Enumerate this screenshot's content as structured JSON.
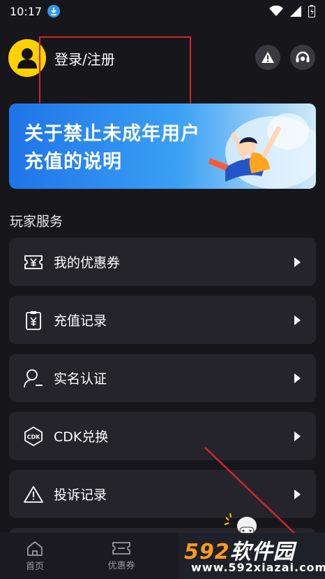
{
  "status_bar": {
    "time": "10:17"
  },
  "header": {
    "login_label": "登录/注册"
  },
  "banner": {
    "line1": "关于禁止未成年用户",
    "line2": "充值的说明"
  },
  "section": {
    "title": "玩家服务"
  },
  "menu": {
    "items": [
      {
        "label": "我的优惠券",
        "icon": "coupon-icon"
      },
      {
        "label": "充值记录",
        "icon": "recharge-record-icon"
      },
      {
        "label": "实名认证",
        "icon": "user-verify-icon"
      },
      {
        "label": "CDK兑换",
        "icon": "cdk-icon"
      },
      {
        "label": "投诉记录",
        "icon": "warning-icon"
      }
    ]
  },
  "tabs": [
    {
      "label": "首页",
      "icon": "home-icon"
    },
    {
      "label": "优惠券",
      "icon": "ticket-icon"
    }
  ],
  "watermark": {
    "brand_num": "592",
    "brand_text": "软件园",
    "url": "www.592xiazai.com"
  },
  "colors": {
    "background": "#17161b",
    "card": "#25242b",
    "accent_yellow": "#ffd100",
    "banner_blue": "#1f74e8",
    "annotation_red": "#d3252d"
  }
}
